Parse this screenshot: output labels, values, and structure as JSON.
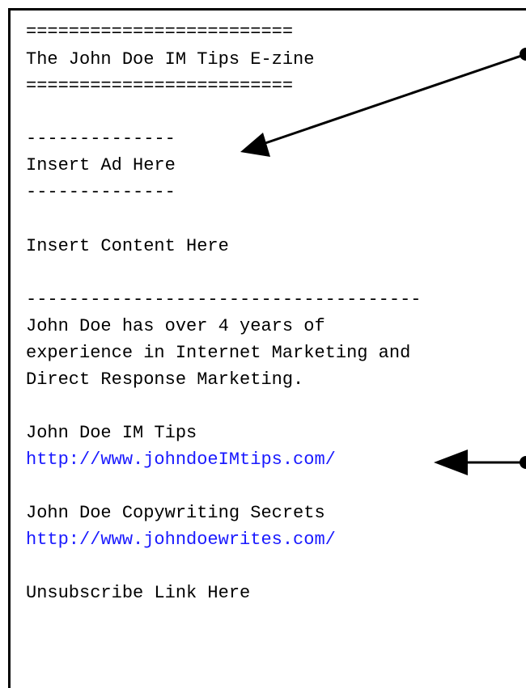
{
  "newsletter": {
    "title_rule_top": "=========================",
    "title": "The John Doe IM Tips E-zine",
    "title_rule_bottom": "=========================",
    "ad_rule_top": "--------------",
    "ad_placeholder": "Insert Ad Here",
    "ad_rule_bottom": "--------------",
    "content_placeholder": "Insert Content Here",
    "bio_rule": "-------------------------------------",
    "bio_line_1": "John Doe has over 4 years of",
    "bio_line_2": "experience in Internet Marketing and",
    "bio_line_3": "Direct Response Marketing.",
    "link_1_name": "John Doe IM Tips",
    "link_1_url": "http://www.johndoeIMtips.com/",
    "link_2_name": "John Doe Copywriting Secrets",
    "link_2_url": "http://www.johndoewrites.com/",
    "unsubscribe": "Unsubscribe Link Here"
  },
  "colors": {
    "text": "#000000",
    "link": "#1a1aff",
    "border": "#000000"
  }
}
